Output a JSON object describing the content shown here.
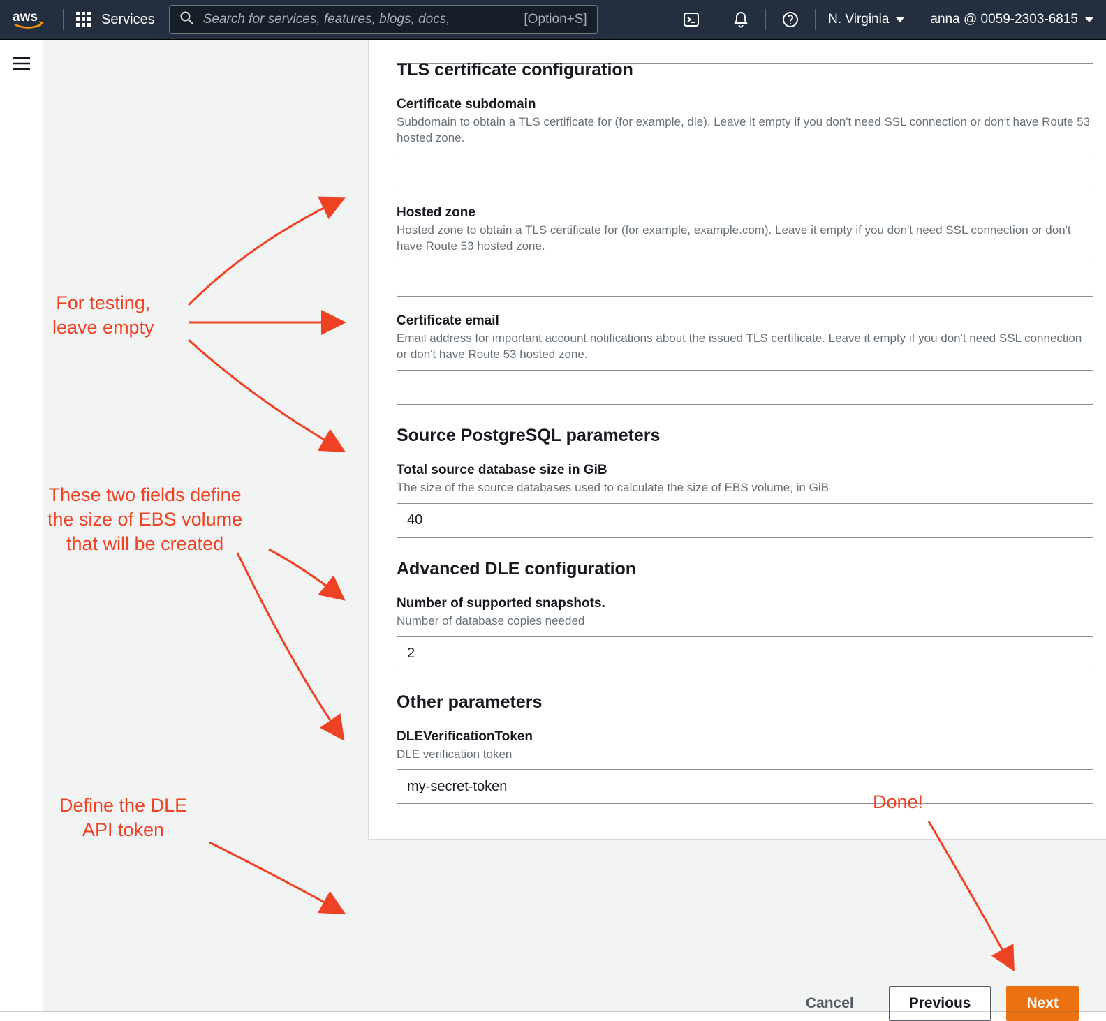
{
  "nav": {
    "services_label": "Services",
    "search_placeholder": "Search for services, features, blogs, docs,",
    "kbd_hint": "[Option+S]",
    "region": "N. Virginia",
    "account": "anna @ 0059-2303-6815"
  },
  "form": {
    "tls": {
      "heading": "TLS certificate configuration",
      "subdomain": {
        "label": "Certificate subdomain",
        "help": "Subdomain to obtain a TLS certificate for (for example, dle). Leave it empty if you don't need SSL connection or don't have Route 53 hosted zone.",
        "value": ""
      },
      "zone": {
        "label": "Hosted zone",
        "help": "Hosted zone to obtain a TLS certificate for (for example, example.com). Leave it empty if you don't need SSL connection or don't have Route 53 hosted zone.",
        "value": ""
      },
      "email": {
        "label": "Certificate email",
        "help": "Email address for important account notifications about the issued TLS certificate. Leave it empty if you don't need SSL connection or don't have Route 53 hosted zone.",
        "value": ""
      }
    },
    "pg": {
      "heading": "Source PostgreSQL parameters",
      "size": {
        "label": "Total source database size in GiB",
        "help": "The size of the source databases used to calculate the size of EBS volume, in GiB",
        "value": "40"
      }
    },
    "adv": {
      "heading": "Advanced DLE configuration",
      "snapshots": {
        "label": "Number of supported snapshots.",
        "help": "Number of database copies needed",
        "value": "2"
      }
    },
    "other": {
      "heading": "Other parameters",
      "token": {
        "label": "DLEVerificationToken",
        "help": "DLE verification token",
        "value": "my-secret-token"
      }
    }
  },
  "footer": {
    "cancel": "Cancel",
    "previous": "Previous",
    "next": "Next"
  },
  "annot": {
    "empty": "For testing,\nleave empty",
    "ebs": "These two fields define\nthe size of EBS volume\nthat will be created",
    "token": "Define the DLE\nAPI token",
    "done": "Done!"
  }
}
